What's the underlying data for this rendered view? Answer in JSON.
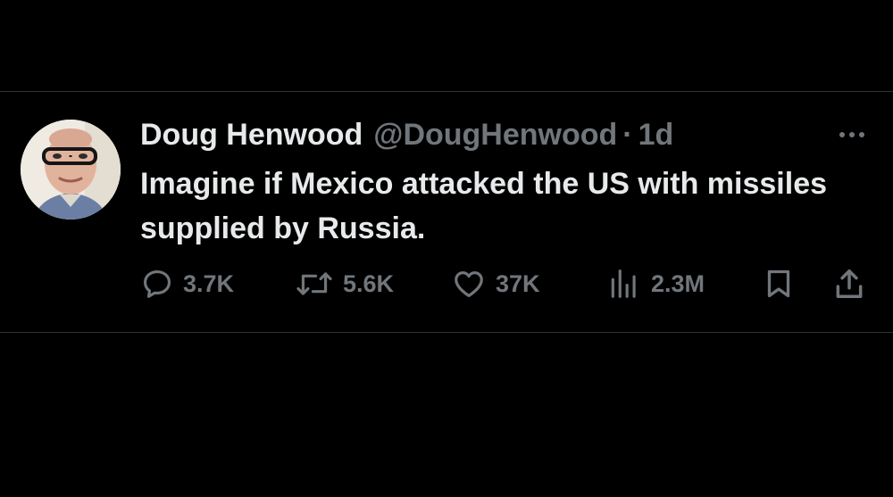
{
  "tweet": {
    "author": {
      "display_name": "Doug Henwood",
      "handle": "@DougHenwood"
    },
    "separator": "·",
    "timestamp": "1d",
    "text": "Imagine if Mexico attacked the US with missiles supplied by Russia.",
    "more_icon": "more-horizontal-icon",
    "actions": {
      "reply": {
        "icon": "reply-icon",
        "count": "3.7K"
      },
      "retweet": {
        "icon": "retweet-icon",
        "count": "5.6K"
      },
      "like": {
        "icon": "heart-icon",
        "count": "37K"
      },
      "views": {
        "icon": "views-icon",
        "count": "2.3M"
      },
      "bookmark": {
        "icon": "bookmark-icon"
      },
      "share": {
        "icon": "share-icon"
      }
    }
  },
  "colors": {
    "background": "#000000",
    "primary_text": "#e7e9ea",
    "secondary_text": "#71767b",
    "divider": "#2f3336"
  }
}
